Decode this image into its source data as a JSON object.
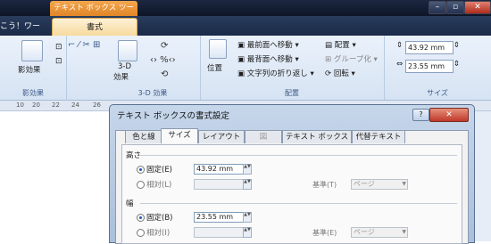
{
  "title_bar": {
    "context_tab": "テキスト ボックス ツール",
    "min": "–",
    "max": "▫",
    "close": "✕"
  },
  "ribbon_tabs": {
    "left_tab": "こう！ワード",
    "format_tab": "書式"
  },
  "ribbon": {
    "shadow_effect": "影効果",
    "shadow_group": "影効果",
    "three_d_effect_line1": "3-D",
    "three_d_effect_line2": "効果",
    "three_d_group": "3-D 効果",
    "position": "位置",
    "bring_front": "最前面へ移動",
    "send_back": "最背面へ移動",
    "text_wrap": "文字列の折り返し",
    "align": "配置",
    "group": "グループ化",
    "rotate": "回転",
    "arrange_group": "配置",
    "height_value": "43.92 mm",
    "width_value": "23.55 mm",
    "size_group": "サイズ"
  },
  "ruler": {
    "ticks": [
      "10",
      "20",
      "22",
      "24",
      "26"
    ]
  },
  "dialog": {
    "title": "テキスト ボックスの書式設定",
    "help": "?",
    "close": "✕",
    "tabs": [
      "色と線",
      "サイズ",
      "レイアウト",
      "図",
      "テキスト ボックス",
      "代替テキスト"
    ],
    "height_section": "高さ",
    "fixed_e": "固定(E)",
    "height_value": "43.92 mm",
    "relative_l": "相対(L)",
    "basis_t": "基準(T)",
    "page_1": "ページ",
    "width_section": "幅",
    "fixed_b": "固定(B)",
    "width_value": "23.55 mm",
    "relative_i": "相対(I)",
    "basis_e": "基準(E)",
    "page_2": "ページ"
  }
}
